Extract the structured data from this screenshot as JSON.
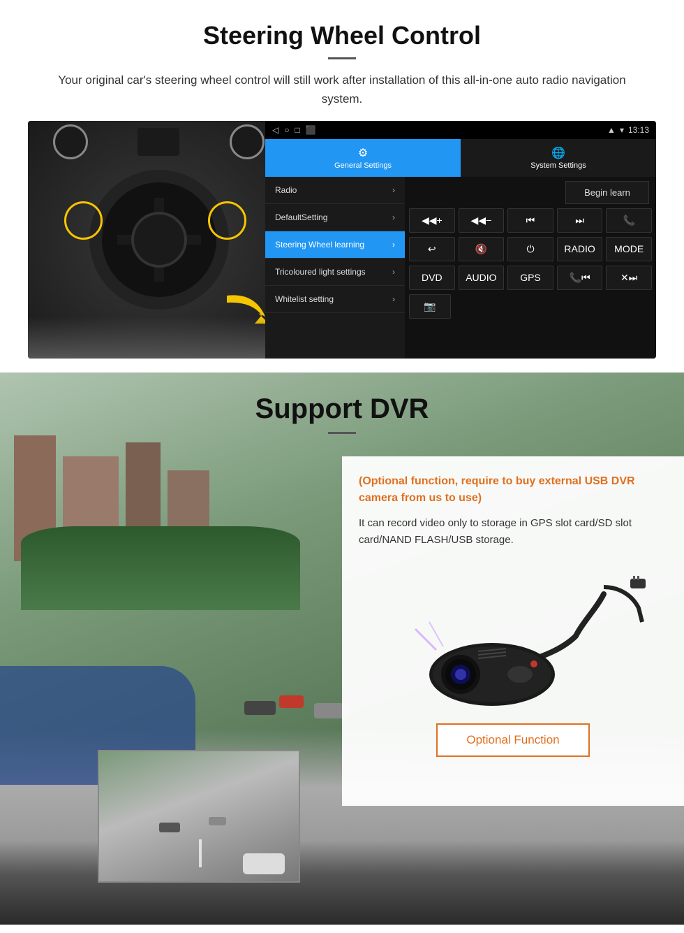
{
  "section1": {
    "title": "Steering Wheel Control",
    "description": "Your original car's steering wheel control will still work after installation of this all-in-one auto radio navigation system.",
    "statusbar": {
      "time": "13:13",
      "icons": [
        "◁",
        "○",
        "□",
        "⬛"
      ]
    },
    "tabs": {
      "general": "General Settings",
      "system": "System Settings"
    },
    "menu": {
      "items": [
        {
          "label": "Radio",
          "active": false
        },
        {
          "label": "DefaultSetting",
          "active": false
        },
        {
          "label": "Steering Wheel learning",
          "active": true
        },
        {
          "label": "Tricoloured light settings",
          "active": false
        },
        {
          "label": "Whitelist setting",
          "active": false
        }
      ]
    },
    "controls": {
      "begin_learn": "Begin learn",
      "row1": [
        "◀◀+",
        "◀◀−",
        "◀◀",
        "▶▶",
        "📞"
      ],
      "row2": [
        "↩",
        "🔇×",
        "⏻",
        "RADIO",
        "MODE"
      ],
      "row3": [
        "DVD",
        "AUDIO",
        "GPS",
        "📞◀◀",
        "✕▶▶"
      ],
      "row4": [
        "📷"
      ]
    }
  },
  "section2": {
    "title": "Support DVR",
    "optional_title": "(Optional function, require to buy external USB DVR camera from us to use)",
    "description": "It can record video only to storage in GPS slot card/SD slot card/NAND FLASH/USB storage.",
    "optional_function_btn": "Optional Function"
  }
}
